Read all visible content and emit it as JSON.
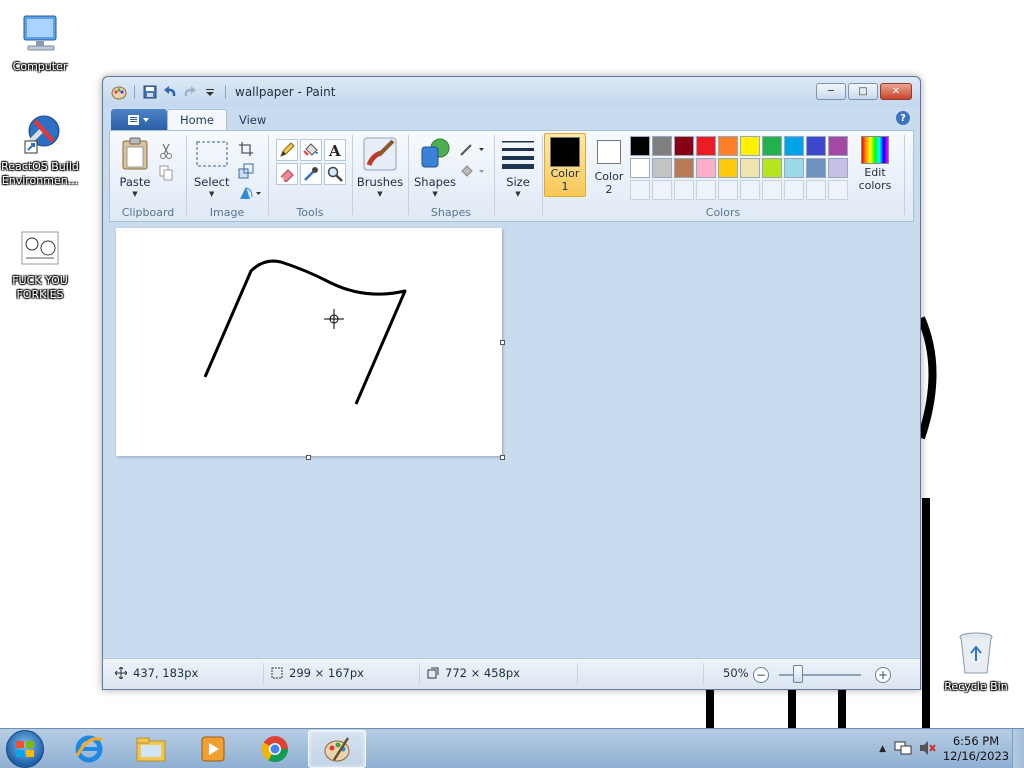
{
  "desktop": {
    "icons": [
      {
        "label": "Computer",
        "icon": "computer-icon"
      },
      {
        "label": "ReactOS Build Environmen...",
        "icon": "reactos-build-icon"
      },
      {
        "label": "FUCK YOU FORKIES",
        "icon": "meme-image-icon"
      },
      {
        "label": "Recycle Bin",
        "icon": "recycle-bin-icon"
      }
    ]
  },
  "window": {
    "title": "wallpaper - Paint",
    "quick_access": [
      "paint-app-icon",
      "save-icon",
      "undo-icon",
      "redo-icon",
      "customize-dropdown-icon"
    ],
    "controls": {
      "minimize": "─",
      "maximize": "□",
      "close": "✕"
    }
  },
  "ribbon": {
    "tabs": [
      "Home",
      "View"
    ],
    "active_tab": "Home",
    "help": "?",
    "groups": {
      "clipboard": {
        "name": "Clipboard",
        "paste": "Paste"
      },
      "image": {
        "name": "Image",
        "select": "Select"
      },
      "tools": {
        "name": "Tools"
      },
      "brushes": {
        "label": "Brushes"
      },
      "shapes": {
        "name": "Shapes",
        "label": "Shapes"
      },
      "size": {
        "label": "Size"
      },
      "colors": {
        "name": "Colors",
        "color1_label": "Color\n1",
        "color2_label": "Color\n2",
        "color1_line1": "Color",
        "color1_line2": "1",
        "color2_line1": "Color",
        "color2_line2": "2",
        "color1": "#000000",
        "color2": "#ffffff",
        "edit_line1": "Edit",
        "edit_line2": "colors",
        "palette_row1": [
          "#000000",
          "#7f7f7f",
          "#880015",
          "#ed1c24",
          "#ff7f27",
          "#fff200",
          "#22b14c",
          "#00a2e8",
          "#3f48cc",
          "#a349a4"
        ],
        "palette_row2": [
          "#ffffff",
          "#c3c3c3",
          "#b97a57",
          "#ffaec9",
          "#ffc90e",
          "#efe4b0",
          "#b5e61d",
          "#99d9ea",
          "#7092be",
          "#c8bfe7"
        ]
      }
    }
  },
  "statusbar": {
    "cursor_pos": "437, 183px",
    "selection_size": "299 × 167px",
    "image_size": "772 × 458px",
    "zoom": "50%",
    "zoom_level": 0.5
  },
  "taskbar": {
    "apps": [
      "internet-explorer-icon",
      "file-explorer-icon",
      "media-player-icon",
      "chrome-icon",
      "paint-icon"
    ],
    "active_app": "paint-icon",
    "time": "6:56 PM",
    "date": "12/16/2023"
  }
}
